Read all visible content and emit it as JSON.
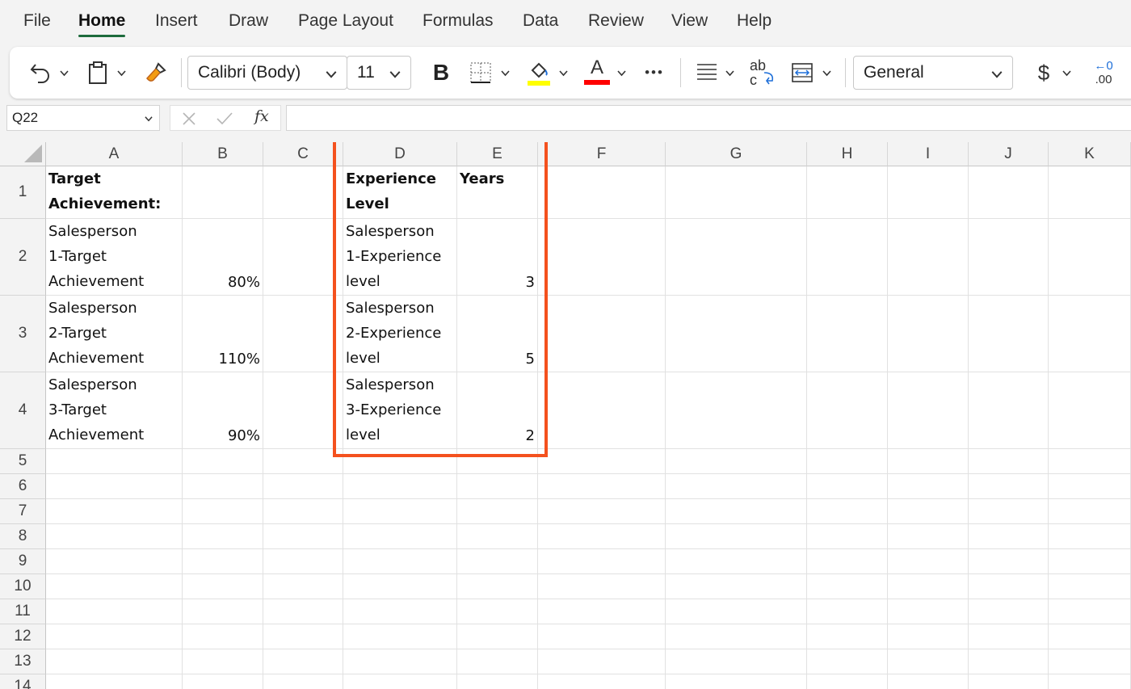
{
  "menu": {
    "tabs": [
      "File",
      "Home",
      "Insert",
      "Draw",
      "Page Layout",
      "Formulas",
      "Data",
      "Review",
      "View",
      "Help"
    ],
    "active": "Home"
  },
  "ribbon": {
    "font_name": "Calibri (Body)",
    "font_size": "11",
    "bold_label": "B",
    "font_color_label": "A",
    "more_label": "•••",
    "number_format": "General",
    "currency_label": "$",
    "wrap_label_top": "ab",
    "wrap_label_bottom": "c",
    "decimal_top": "←0",
    "decimal_bottom": ".00",
    "fill_color": "#ffff00",
    "font_color": "#ff0000",
    "accent": "#1d6b3c"
  },
  "formula_bar": {
    "name_box": "Q22",
    "fx_label": "fx",
    "formula": ""
  },
  "grid": {
    "columns": [
      "A",
      "B",
      "C",
      "D",
      "E",
      "F",
      "G",
      "H",
      "I",
      "J",
      "K"
    ],
    "rows": [
      "1",
      "2",
      "3",
      "4",
      "5",
      "6",
      "7",
      "8",
      "9",
      "10",
      "11",
      "12",
      "13",
      "14"
    ],
    "cells": {
      "A1": "Target\nAchievement:",
      "D1": "Experience\nLevel",
      "E1": "Years",
      "A2": "Salesperson\n1-Target\nAchievement",
      "B2": "80%",
      "D2": "Salesperson\n1-Experience\nlevel",
      "E2": "3",
      "A3": "Salesperson\n2-Target\nAchievement",
      "B3": "110%",
      "D3": "Salesperson\n2-Experience\nlevel",
      "E3": "5",
      "A4": "Salesperson\n3-Target\nAchievement",
      "B4": "90%",
      "D4": "Salesperson\n3-Experience\nlevel",
      "E4": "2"
    },
    "highlight_color": "#f4511e"
  }
}
